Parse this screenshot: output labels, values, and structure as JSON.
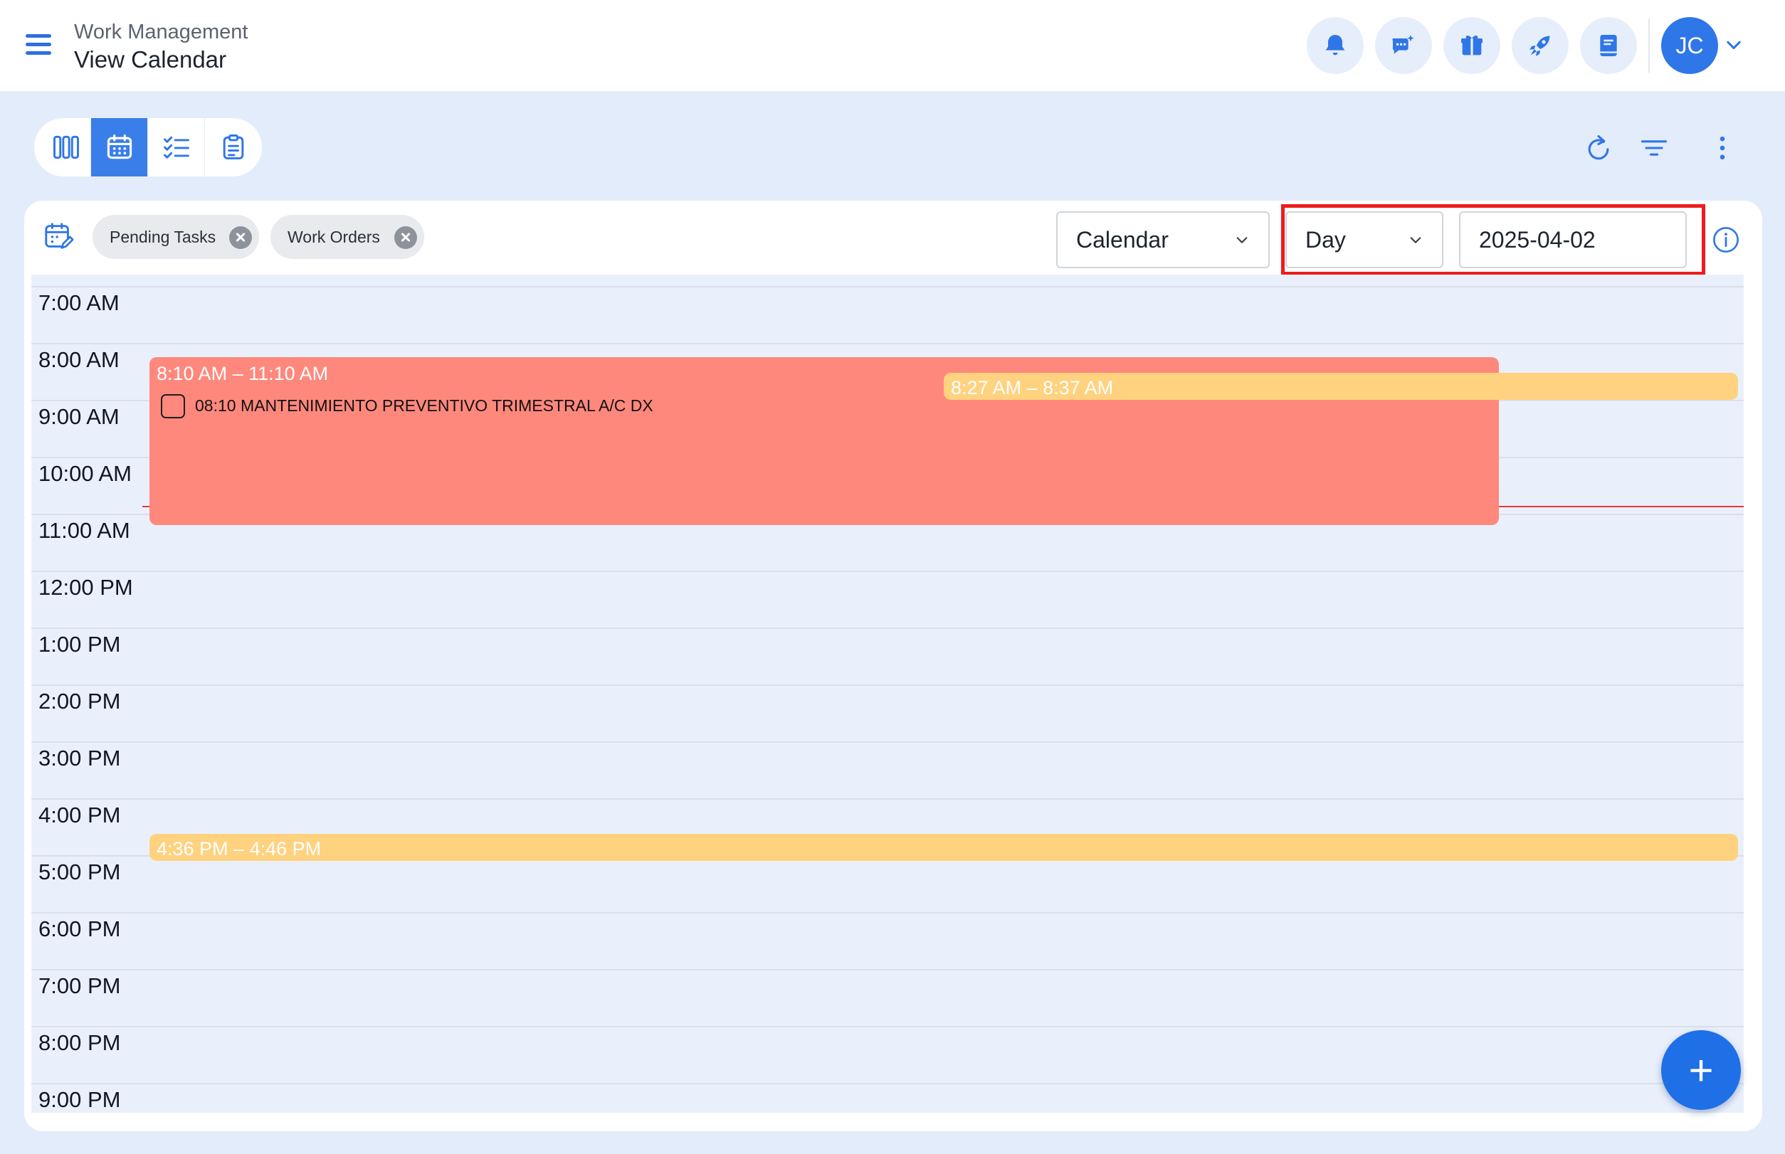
{
  "header": {
    "breadcrumb": "Work Management",
    "title": "View Calendar",
    "user_initials": "JC",
    "icons": [
      "bell-icon",
      "chat-sparkle-icon",
      "gift-icon",
      "rocket-icon",
      "book-icon"
    ]
  },
  "view_switcher": {
    "views": [
      "board-view",
      "calendar-view",
      "task-list-view",
      "clipboard-view"
    ],
    "active": "calendar-view"
  },
  "toolbar": {
    "actions": [
      "refresh-icon",
      "filter-icon",
      "more-vertical-icon"
    ]
  },
  "filters": {
    "chips": [
      "Pending Tasks",
      "Work Orders"
    ]
  },
  "controls": {
    "display_mode": "Calendar",
    "period": "Day",
    "date": "2025-04-02"
  },
  "calendar": {
    "hours": [
      "7:00 AM",
      "8:00 AM",
      "9:00 AM",
      "10:00 AM",
      "11:00 AM",
      "12:00 PM",
      "1:00 PM",
      "2:00 PM",
      "3:00 PM",
      "4:00 PM",
      "5:00 PM",
      "6:00 PM",
      "7:00 PM",
      "8:00 PM",
      "9:00 PM"
    ],
    "events": [
      {
        "time": "8:10 AM – 11:10 AM",
        "title": "08:10 MANTENIMIENTO PREVENTIVO TRIMESTRAL A/C DX",
        "color": "#ff887d"
      },
      {
        "time": "8:27 AM – 8:37 AM",
        "color": "#ffd27f"
      },
      {
        "time": "4:36 PM – 4:46 PM",
        "color": "#ffd27f"
      }
    ],
    "now_line_color": "#e23b3b"
  },
  "fab": {
    "label": "+"
  },
  "colors": {
    "accent": "#2f76e8",
    "highlight": "#ee1c1c"
  }
}
